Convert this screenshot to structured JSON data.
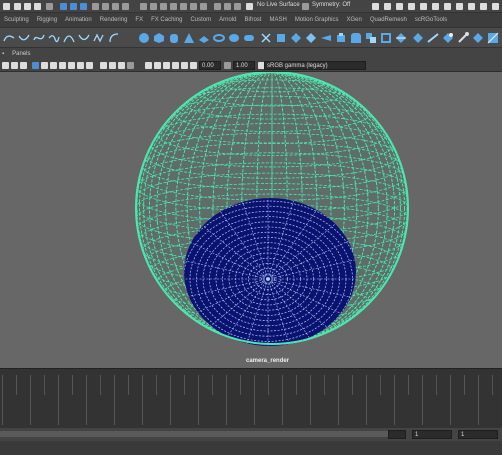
{
  "topbar": {
    "live_surface": "No Live Surface",
    "symmetry": "Symmetry: Off"
  },
  "shelf_tabs": [
    "Sculpting",
    "Rigging",
    "Animation",
    "Rendering",
    "FX",
    "FX Caching",
    "Custom",
    "Arnold",
    "Bifrost",
    "MASH",
    "Motion Graphics",
    "XGen",
    "QuadRemesh",
    "scRGoTools"
  ],
  "panel_menu": [
    "Panels"
  ],
  "panel_tools": {
    "exposure": "0.00",
    "gamma": "1.00",
    "color_space": "sRGB gamma (legacy)"
  },
  "viewport": {
    "camera_label": "camera_render"
  },
  "range": {
    "start": "1",
    "end": "1"
  },
  "colors": {
    "wire": "#4ee6b0",
    "fill": "#0a1470"
  }
}
